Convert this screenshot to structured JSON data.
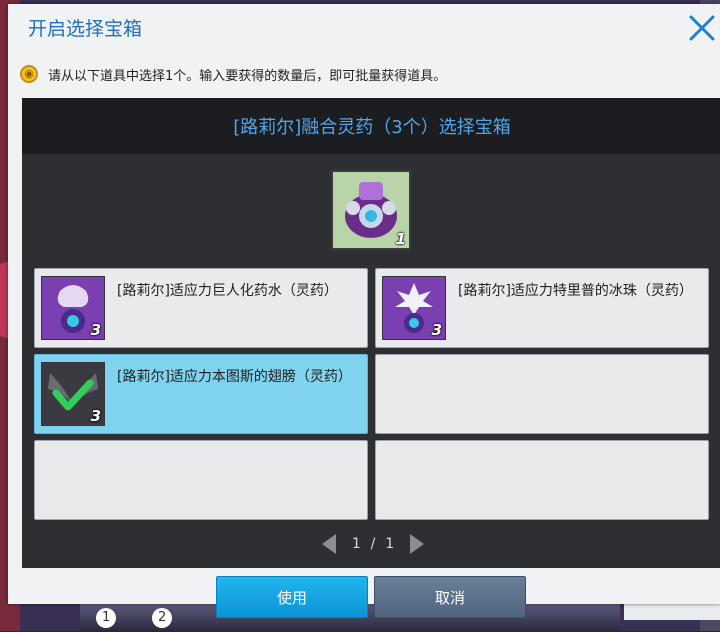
{
  "dialog": {
    "title": "开启选择宝箱",
    "notice": "请从以下道具中选择1个。输入要获得的数量后，即可批量获得道具。",
    "notice_icon": "coin-icon",
    "panel_title": "[路莉尔]融合灵药（3个）选择宝箱",
    "preview": {
      "icon": "potion-box-icon",
      "quantity": "1"
    },
    "slots": [
      {
        "label": "[路莉尔]适应力巨人化药水（灵药）",
        "quantity": "3",
        "icon": "giant-potion-icon",
        "selected": false
      },
      {
        "label": "[路莉尔]适应力特里普的冰珠（灵药）",
        "quantity": "3",
        "icon": "ice-bead-icon",
        "selected": false
      },
      {
        "label": "[路莉尔]适应力本图斯的翅膀（灵药）",
        "quantity": "3",
        "icon": "wings-icon",
        "selected": true
      },
      {
        "label": "",
        "quantity": "",
        "icon": "",
        "selected": false
      },
      {
        "label": "",
        "quantity": "",
        "icon": "",
        "selected": false
      },
      {
        "label": "",
        "quantity": "",
        "icon": "",
        "selected": false
      }
    ],
    "pager": {
      "current": "1",
      "separator": "/",
      "total": "1"
    },
    "buttons": {
      "use": "使用",
      "cancel": "取消"
    }
  },
  "background": {
    "bottom_badges": [
      "1",
      "2"
    ]
  },
  "colors": {
    "title": "#1f6fc4",
    "panel_title": "#4fa6ea",
    "selected_slot": "#7fd3ee",
    "use_button": "#13a4e2",
    "cancel_button": "#5d7189"
  }
}
